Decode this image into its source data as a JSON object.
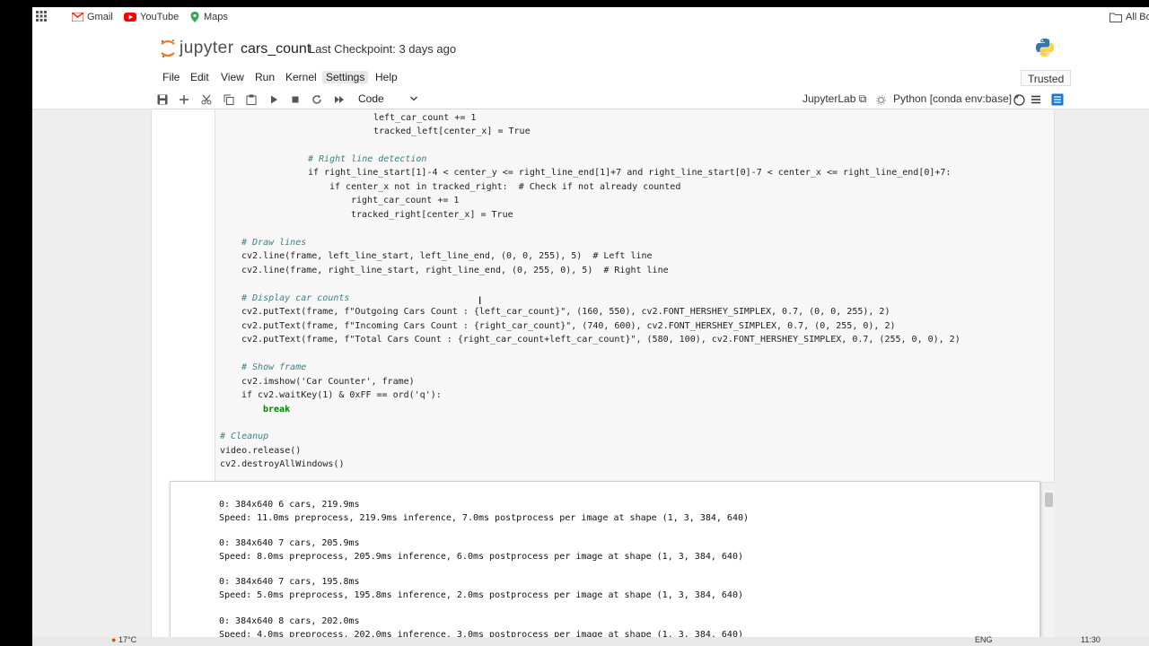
{
  "bookmarks": [
    {
      "label": "Gmail",
      "icon": "gmail-icon"
    },
    {
      "label": "YouTube",
      "icon": "youtube-icon"
    },
    {
      "label": "Maps",
      "icon": "maps-icon"
    }
  ],
  "bookmarks_right": "All Bo",
  "header": {
    "logo_text": "jupyter",
    "notebook_name": "cars_count",
    "checkpoint": "Last Checkpoint: 3 days ago"
  },
  "menu": [
    "File",
    "Edit",
    "View",
    "Run",
    "Kernel",
    "Settings",
    "Help"
  ],
  "trusted": "Trusted",
  "toolbar": {
    "cell_type": "Code",
    "jupyterlab": "JupyterLab",
    "kernel": "Python [conda env:base] *"
  },
  "code_lines": [
    "left_car_count += 1",
    "tracked_left[center_x] = True",
    "# Right line detection",
    "if right_line_start[1]-4 < center_y <= right_line_end[1]+7 and right_line_start[0]-7 < center_x <= right_line_end[0]+7:",
    "if center_x not in tracked_right:  # Check if not already counted",
    "right_car_count += 1",
    "tracked_right[center_x] = True",
    "# Draw lines",
    "cv2.line(frame, left_line_start, left_line_end, (0, 0, 255), 5)  # Left line",
    "cv2.line(frame, right_line_start, right_line_end, (0, 255, 0), 5)  # Right line",
    "# Display car counts",
    "cv2.putText(frame, f\"Outgoing Cars Count : {left_car_count}\", (160, 550), cv2.FONT_HERSHEY_SIMPLEX, 0.7, (0, 0, 255), 2)",
    "cv2.putText(frame, f\"Incoming Cars Count : {right_car_count}\", (740, 600), cv2.FONT_HERSHEY_SIMPLEX, 0.7, (0, 255, 0), 2)",
    "cv2.putText(frame, f\"Total Cars Count : {right_car_count+left_car_count}\", (580, 100), cv2.FONT_HERSHEY_SIMPLEX, 0.7, (255, 0, 0), 2)",
    "# Show frame",
    "cv2.imshow('Car Counter', frame)",
    "if cv2.waitKey(1) & 0xFF == ord('q'):",
    "break",
    "# Cleanup",
    "video.release()",
    "cv2.destroyAllWindows()"
  ],
  "output_lines": [
    "0: 384x640 6 cars, 219.9ms",
    "Speed: 11.0ms preprocess, 219.9ms inference, 7.0ms postprocess per image at shape (1, 3, 384, 640)",
    "0: 384x640 7 cars, 205.9ms",
    "Speed: 8.0ms preprocess, 205.9ms inference, 6.0ms postprocess per image at shape (1, 3, 384, 640)",
    "0: 384x640 7 cars, 195.8ms",
    "Speed: 5.0ms preprocess, 195.8ms inference, 2.0ms postprocess per image at shape (1, 3, 384, 640)",
    "0: 384x640 8 cars, 202.0ms",
    "Speed: 4.0ms preprocess, 202.0ms inference, 3.0ms postprocess per image at shape (1, 3, 384, 640)"
  ],
  "taskbar": {
    "weather": "17°C",
    "lang": "ENG",
    "time": "11:30"
  },
  "colors": {
    "accent": "#f37726",
    "comment": "#408080",
    "keyword": "#008000",
    "string": "#ba2121"
  }
}
